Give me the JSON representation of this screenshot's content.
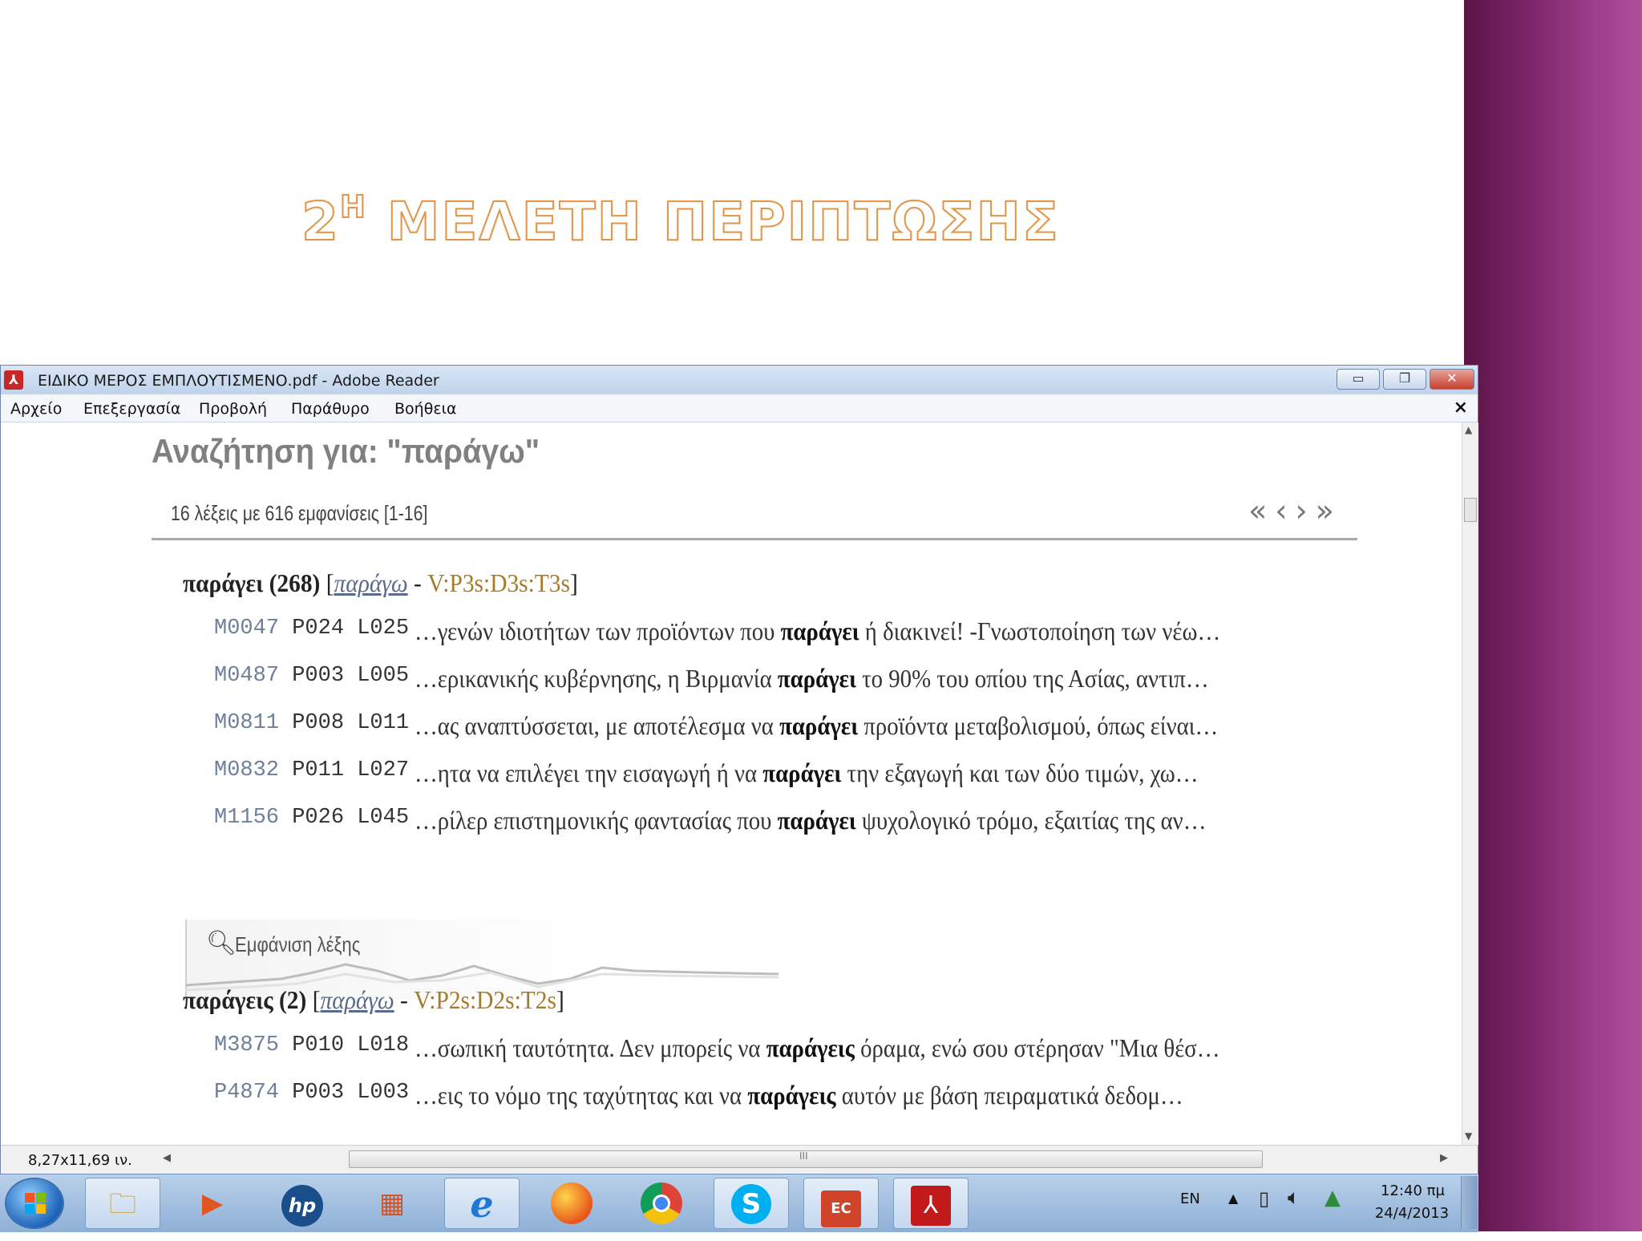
{
  "slide": {
    "title_number": "2",
    "title_sup": "Η",
    "title_text": "ΜΕΛΕΤΗ ΠΕΡΙΠΤΩΣΗΣ",
    "accent_color": "#e0964a",
    "band_color": "#7a2468"
  },
  "window": {
    "title": "ΕΙΔΙΚΟ ΜΕΡΟΣ ΕΜΠΛΟΥΤΙΣΜΕΝΟ.pdf - Adobe Reader",
    "app_icon": "pdf-icon",
    "buttons": {
      "minimize": "▭",
      "restore": "❐",
      "close": "✕"
    },
    "menu": {
      "file": "Αρχείο",
      "edit": "Επεξεργασία",
      "view": "Προβολή",
      "window": "Παράθυρο",
      "help": "Βοήθεια",
      "close_doc": "×"
    }
  },
  "document": {
    "heading": "Αναζήτηση για: \"παράγω\"",
    "result_count": "16 λέξεις με 616 εμφανίσεις [1-16]",
    "pager": {
      "first": "«",
      "prev": "‹",
      "next": "›",
      "last": "»"
    },
    "entries": [
      {
        "word": "παράγει",
        "count": "(268)",
        "lemma": "παράγω",
        "tag": "V:P3s:D3s:T3s",
        "hits": [
          {
            "m": "M0047",
            "pl": "P024 L025",
            "before": "…γενών ιδιοτήτων των προϊόντων που ",
            "match": "παράγει",
            "after": " ή διακινεί! -Γνωστοποίηση των νέω…"
          },
          {
            "m": "M0487",
            "pl": "P003 L005",
            "before": "…ερικανικής κυβέρνησης, η Βιρμανία ",
            "match": "παράγει",
            "after": " το 90% του οπίου της Ασίας, αντιπ…"
          },
          {
            "m": "M0811",
            "pl": "P008 L011",
            "before": "…ας αναπτύσσεται, με αποτέλεσμα να ",
            "match": "παράγει",
            "after": " προϊόντα μεταβολισμού, όπως είναι…"
          },
          {
            "m": "M0832",
            "pl": "P011 L027",
            "before": "…ητα να επιλέγει την εισαγωγή ή να ",
            "match": "παράγει",
            "after": " την εξαγωγή και των δύο τιμών, χω…"
          },
          {
            "m": "M1156",
            "pl": "P026 L045",
            "before": "…ρίλερ επιστημονικής φαντασίας που ",
            "match": "παράγει",
            "after": " ψυχολογικό τρόμο, εξαιτίας της αν…"
          }
        ],
        "show_word": "Εμφάνιση λέξης"
      },
      {
        "word": "παράγεις",
        "count": "(2)",
        "lemma": "παράγω",
        "tag": "V:P2s:D2s:T2s",
        "hits": [
          {
            "m": "M3875",
            "pl": "P010 L018",
            "before": "…σωπική ταυτότητα. Δεν μπορείς να ",
            "match": "παράγεις",
            "after": " όραμα, ενώ σου στέρησαν \"Μια θέσ…"
          },
          {
            "m": "P4874",
            "pl": "P003 L003",
            "before": "…εις το νόμο της ταχύτητας και να ",
            "match": "παράγεις",
            "after": " αυτόν με βάση πειραματικά δεδομ…"
          }
        ]
      }
    ]
  },
  "statusbar": {
    "page_size": "8,27x11,69 ιν.",
    "hscroll_grip": "III"
  },
  "taskbar": {
    "apps": [
      "windows-start",
      "explorer",
      "media-player",
      "hp",
      "powerpoint-viewer",
      "internet-explorer",
      "firefox",
      "chrome",
      "skype",
      "powerpoint",
      "adobe-reader"
    ],
    "hp_label": "hp",
    "ie_label": "e",
    "skype_label": "S",
    "ppt_label": "EC",
    "acrobat_label": "⅄",
    "tray": {
      "lang": "EN",
      "time": "12:40 πμ",
      "date": "24/4/2013"
    }
  }
}
